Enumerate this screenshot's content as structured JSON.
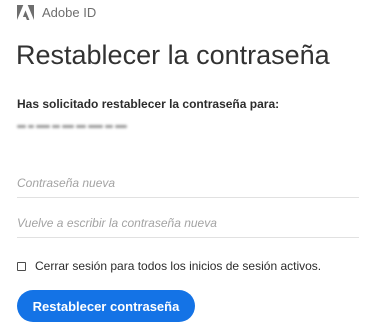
{
  "header": {
    "brand_name": "Adobe ID",
    "logo_icon": "adobe-logo-icon"
  },
  "page": {
    "title": "Restablecer la contraseña",
    "intro": "Has solicitado restablecer la contraseña para:"
  },
  "form": {
    "new_password_placeholder": "Contraseña nueva",
    "confirm_password_placeholder": "Vuelve a escribir la contraseña nueva",
    "sign_out_all_label": "Cerrar sesión para todos los inicios de sesión activos.",
    "sign_out_all_checked": false,
    "submit_label": "Restablecer contraseña"
  },
  "colors": {
    "accent": "#1473e6",
    "text": "#2c2c2c",
    "placeholder": "#a3a3a3",
    "divider": "#e1e1e1"
  }
}
